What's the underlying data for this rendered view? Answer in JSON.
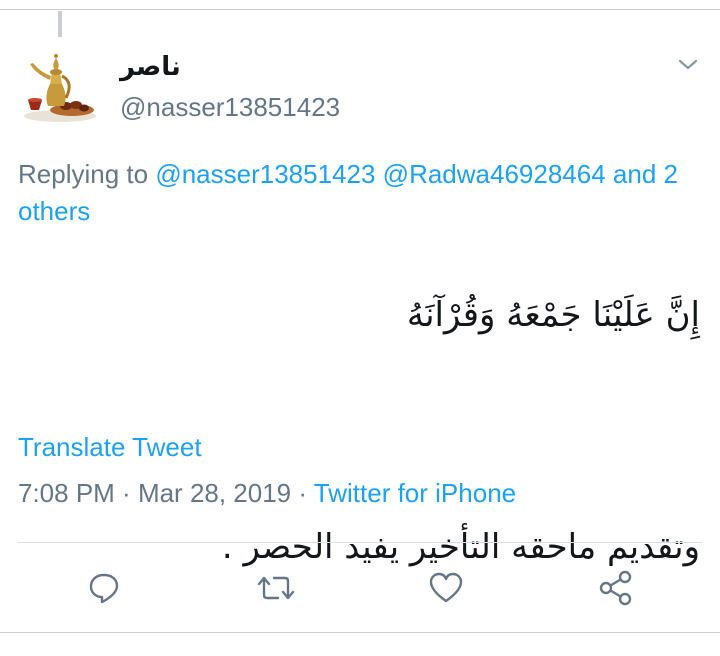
{
  "tweet": {
    "display_name": "ناصر",
    "handle": "@nasser13851423",
    "reply": {
      "prefix": "Replying to",
      "mention_1": "@nasser13851423",
      "mention_2": "@Radwa46928464",
      "suffix": "and 2 others"
    },
    "text_line_1": "إِنَّ عَلَيْنَا جَمْعَهُ وَقُرْآنَهُ",
    "text_line_2": "وتقديم ماحقه التأخير يفيد الحصر ."
  },
  "translate_label": "Translate Tweet",
  "meta": {
    "time": "7:08 PM",
    "separator_1": " · ",
    "date": "Mar 28, 2019",
    "separator_2": " · ",
    "source": "Twitter for iPhone"
  },
  "actions": {
    "reply_icon": "reply-icon",
    "retweet_icon": "retweet-icon",
    "like_icon": "like-icon",
    "share_icon": "share-icon"
  },
  "colors": {
    "link": "#1da1f2",
    "secondary_text": "#657786",
    "primary_text": "#14171a",
    "icon": "#657786"
  }
}
